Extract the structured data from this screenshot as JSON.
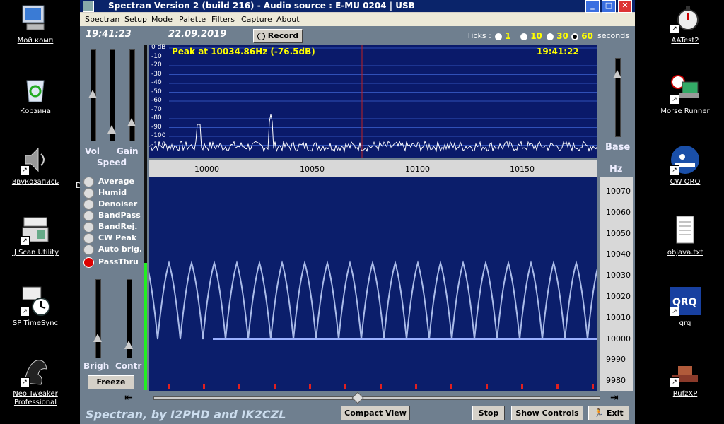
{
  "desktop": {
    "left_icons": [
      {
        "label": "Мой комп",
        "icon": "my-computer-icon"
      },
      {
        "label": "Корзина",
        "icon": "recycle-bin-icon"
      },
      {
        "label": "Звукозапись",
        "icon": "speaker-icon"
      },
      {
        "label": "IJ Scan Utility",
        "icon": "scanner-icon"
      },
      {
        "label": "SP TimeSync",
        "icon": "clock-icon"
      },
      {
        "label": "Neo Tweaker Professional",
        "icon": "dragon-icon"
      }
    ],
    "right_icons": [
      {
        "label": "AATest2",
        "icon": "stopwatch-icon"
      },
      {
        "label": "Morse Runner",
        "icon": "laptop-icon"
      },
      {
        "label": "CW QRQ",
        "icon": "morse-key-icon"
      },
      {
        "label": "objava.txt",
        "icon": "text-file-icon"
      },
      {
        "label": "qrq",
        "icon": "qrq-icon"
      },
      {
        "label": "RufzXP",
        "icon": "morse-key-icon"
      }
    ],
    "partial_label": "D"
  },
  "window": {
    "title": "Spectran Version 2 (build 216) - Audio source  :  E-MU 0204  |  USB",
    "menu": [
      "Spectran",
      "Setup",
      "Mode",
      "Palette",
      "Filters",
      "Capture",
      "About"
    ],
    "time": "19:41:23",
    "date": "22.09.2019",
    "record_label": "Record",
    "ticks_label": "Ticks :",
    "tick_options": [
      "1",
      "10",
      "30",
      "60"
    ],
    "tick_selected": "60",
    "seconds_label": "seconds",
    "peak_text": "Peak at 10034.86Hz (-76.5dB)",
    "spectrum_time": "19:41:22",
    "db_labels": [
      "0 dB",
      "-10",
      "-20",
      "-30",
      "-40",
      "-50",
      "-60",
      "-70",
      "-80",
      "-90",
      "-100",
      "-110"
    ],
    "freq_labels": [
      "10000",
      "10050",
      "10100",
      "10150"
    ],
    "wf_freq_labels": [
      "10070",
      "10060",
      "10050",
      "10040",
      "10030",
      "10020",
      "10010",
      "10000",
      "9990",
      "9980"
    ],
    "slider_labels": {
      "vol": "Vol",
      "gain": "Gain",
      "speed": "Speed",
      "brigh": "Brigh",
      "contr": "Contr",
      "base": "Base",
      "hz": "Hz"
    },
    "options": [
      {
        "label": "Average",
        "on": false
      },
      {
        "label": "Humid",
        "on": false
      },
      {
        "label": "Denoiser",
        "on": false
      },
      {
        "label": "BandPass",
        "on": false
      },
      {
        "label": "BandRej.",
        "on": false
      },
      {
        "label": "CW Peak",
        "on": false
      },
      {
        "label": "Auto brig.",
        "on": false
      },
      {
        "label": "PassThru",
        "on": true
      }
    ],
    "freeze_label": "Freeze",
    "credits": "Spectran, by I2PHD and IK2CZL",
    "compact_view_label": "Compact View",
    "stop_label": "Stop",
    "show_controls_label": "Show Controls",
    "exit_label": "Exit"
  }
}
